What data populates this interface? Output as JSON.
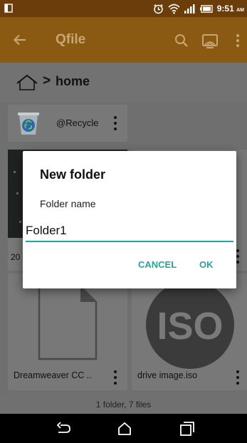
{
  "status_bar": {
    "time": "9:51",
    "ampm": "AM"
  },
  "app_bar": {
    "title": "Qfile",
    "icons": [
      "back-arrow-icon",
      "search-icon",
      "cast-icon",
      "overflow-menu-icon"
    ]
  },
  "breadcrumb": {
    "current": "home",
    "separator": ">"
  },
  "files": [
    {
      "name": "@Recycle",
      "type": "folder"
    },
    {
      "name": "20",
      "type": "image"
    },
    {
      "name": "Dreamweaver CC ..",
      "type": "document"
    },
    {
      "name": "drive image.iso",
      "type": "disc-image"
    }
  ],
  "summary": "1 folder, 7 files",
  "dialog": {
    "title": "New folder",
    "field_label": "Folder name",
    "field_value": "Folder1",
    "cancel_label": "CANCEL",
    "ok_label": "OK"
  },
  "colors": {
    "status_bar": "#6a3d0b",
    "app_bar": "#8a5a12",
    "accent": "#26a69a"
  }
}
